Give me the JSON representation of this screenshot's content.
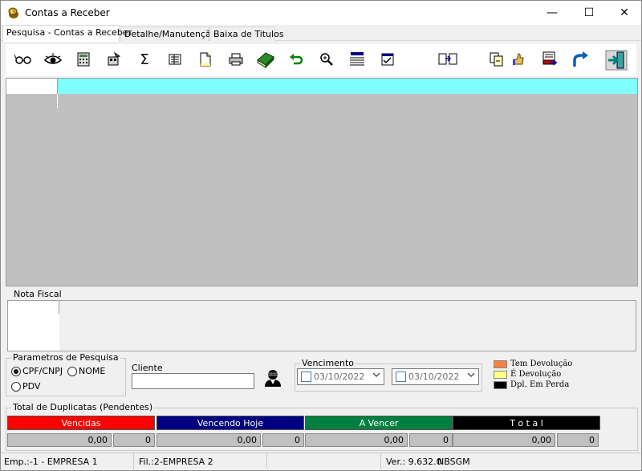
{
  "window": {
    "title": "Contas a Receber",
    "minimize": "—",
    "maximize": "☐",
    "close": "✕"
  },
  "tabs": [
    {
      "label": "Pesquisa - Contas a Receber"
    },
    {
      "label": "Detalhe/Manutenção"
    },
    {
      "label": "Baixa de Titulos"
    }
  ],
  "toolbar": {
    "icons": [
      "glasses-icon",
      "eye-icon",
      "calculator-icon",
      "settings-icon",
      "sigma-icon",
      "report-icon",
      "new-document-icon",
      "printer-icon",
      "book-icon",
      "undo-icon",
      "zoom-icon",
      "list-icon",
      "checklist-icon",
      "transfer-icon",
      "copy-icon",
      "thumbs-up-icon",
      "export-icon",
      "redo-arrow-icon",
      "exit-icon"
    ],
    "sigma": "Σ"
  },
  "nota_fiscal": {
    "legend": "Nota Fiscal"
  },
  "params": {
    "legend": "Parametros de Pesquisa",
    "cpf_label": "CPF/CNPJ",
    "nome_label": "NOME",
    "pdv_label": "PDV",
    "cliente_label": "Cliente",
    "cliente_value": "",
    "vencimento_label": "Vencimento",
    "date_from": "03/10/2022",
    "date_to": "03/10/2022"
  },
  "legend_colors": [
    {
      "label": "Tem Devolução",
      "color": "#ff8040"
    },
    {
      "label": "É Devolução",
      "color": "#ffff80"
    },
    {
      "label": "Dpl. Em Perda",
      "color": "#000000"
    }
  ],
  "totals": {
    "legend": "Total de Duplicatas (Pendentes)",
    "vencidas": {
      "label": "Vencidas",
      "value": "0,00",
      "count": "0",
      "color": "#ff0000"
    },
    "vencendo_hoje": {
      "label": "Vencendo Hoje",
      "value": "0,00",
      "count": "0",
      "color": "#000080"
    },
    "a_vencer": {
      "label": "A Vencer",
      "value": "0,00",
      "count": "0",
      "color": "#008040"
    },
    "total": {
      "label": "T o t a l",
      "value": "0,00",
      "count": "0",
      "color": "#000000"
    }
  },
  "status": {
    "empresa": "Emp.:-1 - EMPRESA 1",
    "filial": "Fil.:2-EMPRESA 2",
    "versao": "Ver.: 9.632.0",
    "sistema": "NBSGM"
  }
}
